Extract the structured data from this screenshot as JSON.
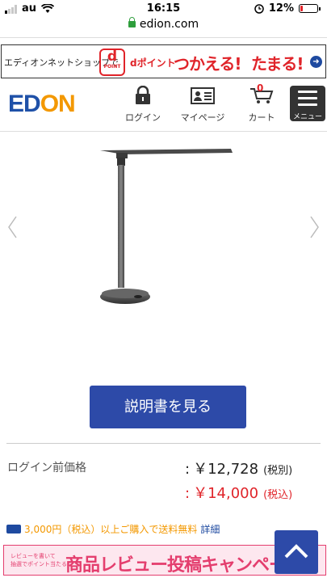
{
  "status_bar": {
    "carrier": "au",
    "time": "16:15",
    "battery": "12%"
  },
  "url": "edion.com",
  "banner": {
    "shop_text": "エディオンネットショップで",
    "dpoint_logo_main": "d",
    "dpoint_logo_sub": "POINT",
    "dpoint_text": "dポイント",
    "use_text": "つかえる!",
    "earn_text": "たまる!"
  },
  "header": {
    "logo_part1": "ED",
    "logo_part2": "ON",
    "login_label": "ログイン",
    "mypage_label": "マイページ",
    "cart_label": "カート",
    "cart_count": "0",
    "menu_label": "メニュー"
  },
  "product": {
    "manual_button": "説明書を見る",
    "price_label": "ログイン前価格",
    "price_ex_tax": "￥12,728",
    "price_ex_tax_note": "(税別)",
    "price_in_tax": "￥14,000",
    "price_in_tax_note": "(税込)",
    "colon": ":"
  },
  "shipping": {
    "text": "3,000円（税込）以上ご購入で送料無料",
    "detail_link": "詳細"
  },
  "review_banner": {
    "small_line1": "レビューを書いて",
    "small_line2": "抽選でポイント当たる",
    "big_text": "商品レビュー投稿キャンペーン"
  },
  "colors": {
    "brand_blue": "#1f51a8",
    "brand_orange": "#f39800",
    "price_red": "#e0242a",
    "button_blue": "#2d4aa8"
  },
  "icons": [
    "wifi-icon",
    "lock-icon",
    "alarm-icon",
    "login-lock-icon",
    "mypage-card-icon",
    "cart-icon",
    "hamburger-icon",
    "chevron-left-icon",
    "chevron-right-icon",
    "truck-icon",
    "arrow-up-icon"
  ]
}
